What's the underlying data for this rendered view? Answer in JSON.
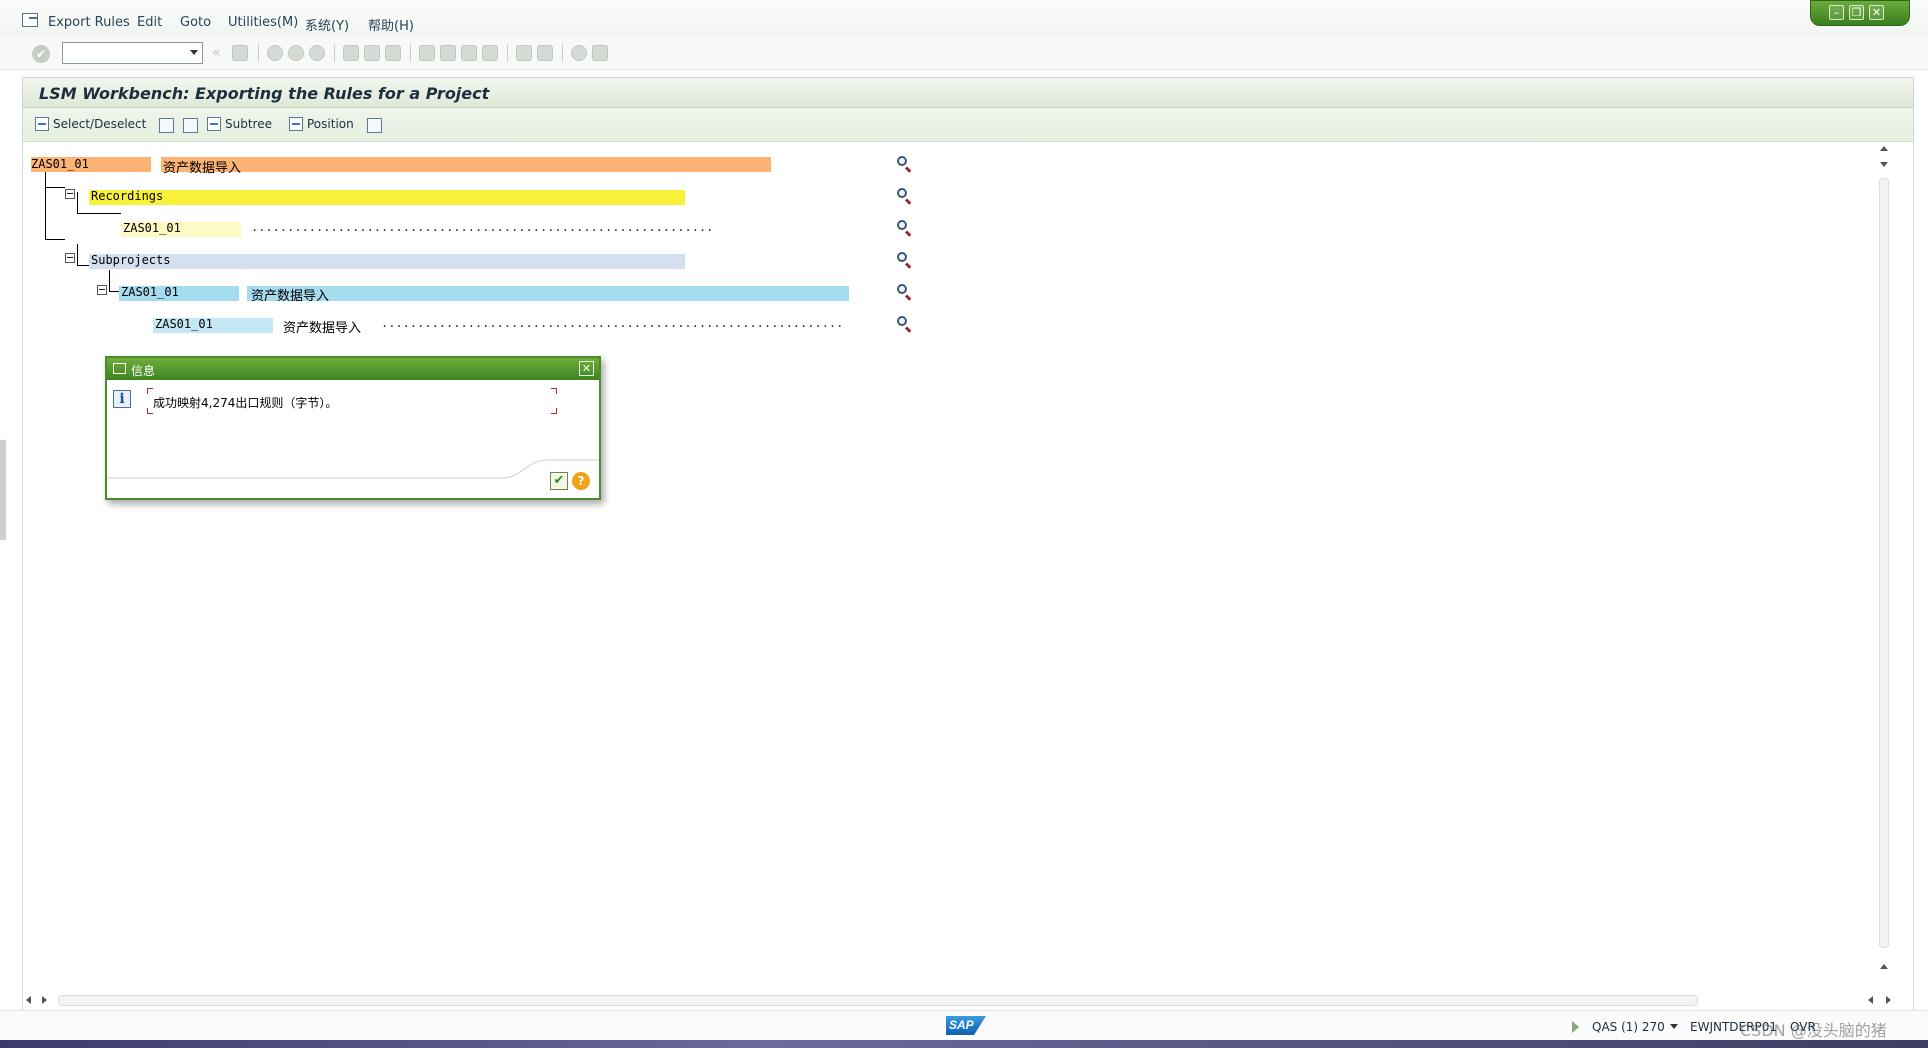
{
  "menu": {
    "items": [
      "Export Rules",
      "Edit",
      "Goto",
      "Utilities(M)",
      "系统(Y)",
      "帮助(H)"
    ]
  },
  "screen": {
    "title": "LSM Workbench: Exporting the Rules for a Project"
  },
  "app_toolbar": {
    "select_deselect": "Select/Deselect",
    "subtree": "Subtree",
    "position": "Position"
  },
  "tree": {
    "root": {
      "key": "ZAS01_01",
      "desc": "资产数据导入",
      "color": "#fcb374"
    },
    "recordings": {
      "label": "Recordings",
      "color": "#f9f03a"
    },
    "recording_item": {
      "key": "ZAS01_01",
      "color": "#fdfac4",
      "dots": "................................................................"
    },
    "subprojects": {
      "label": "Subprojects",
      "color": "#d4e0f0"
    },
    "subproject": {
      "key": "ZAS01_01",
      "desc": "资产数据导入",
      "color": "#a6dcf0"
    },
    "subproject_item": {
      "key": "ZAS01_01",
      "desc": "资产数据导入",
      "color": "#c4e8f4",
      "dots": "................................................................"
    }
  },
  "dialog": {
    "title": "信息",
    "message": "成功映射4,274出口规则（字节）。"
  },
  "status": {
    "system": "QAS (1) 270",
    "server": "EWJNTDERP01",
    "mode": "OVR",
    "sap_logo": "SAP",
    "watermark": "CSDN @没头脑的猪"
  }
}
